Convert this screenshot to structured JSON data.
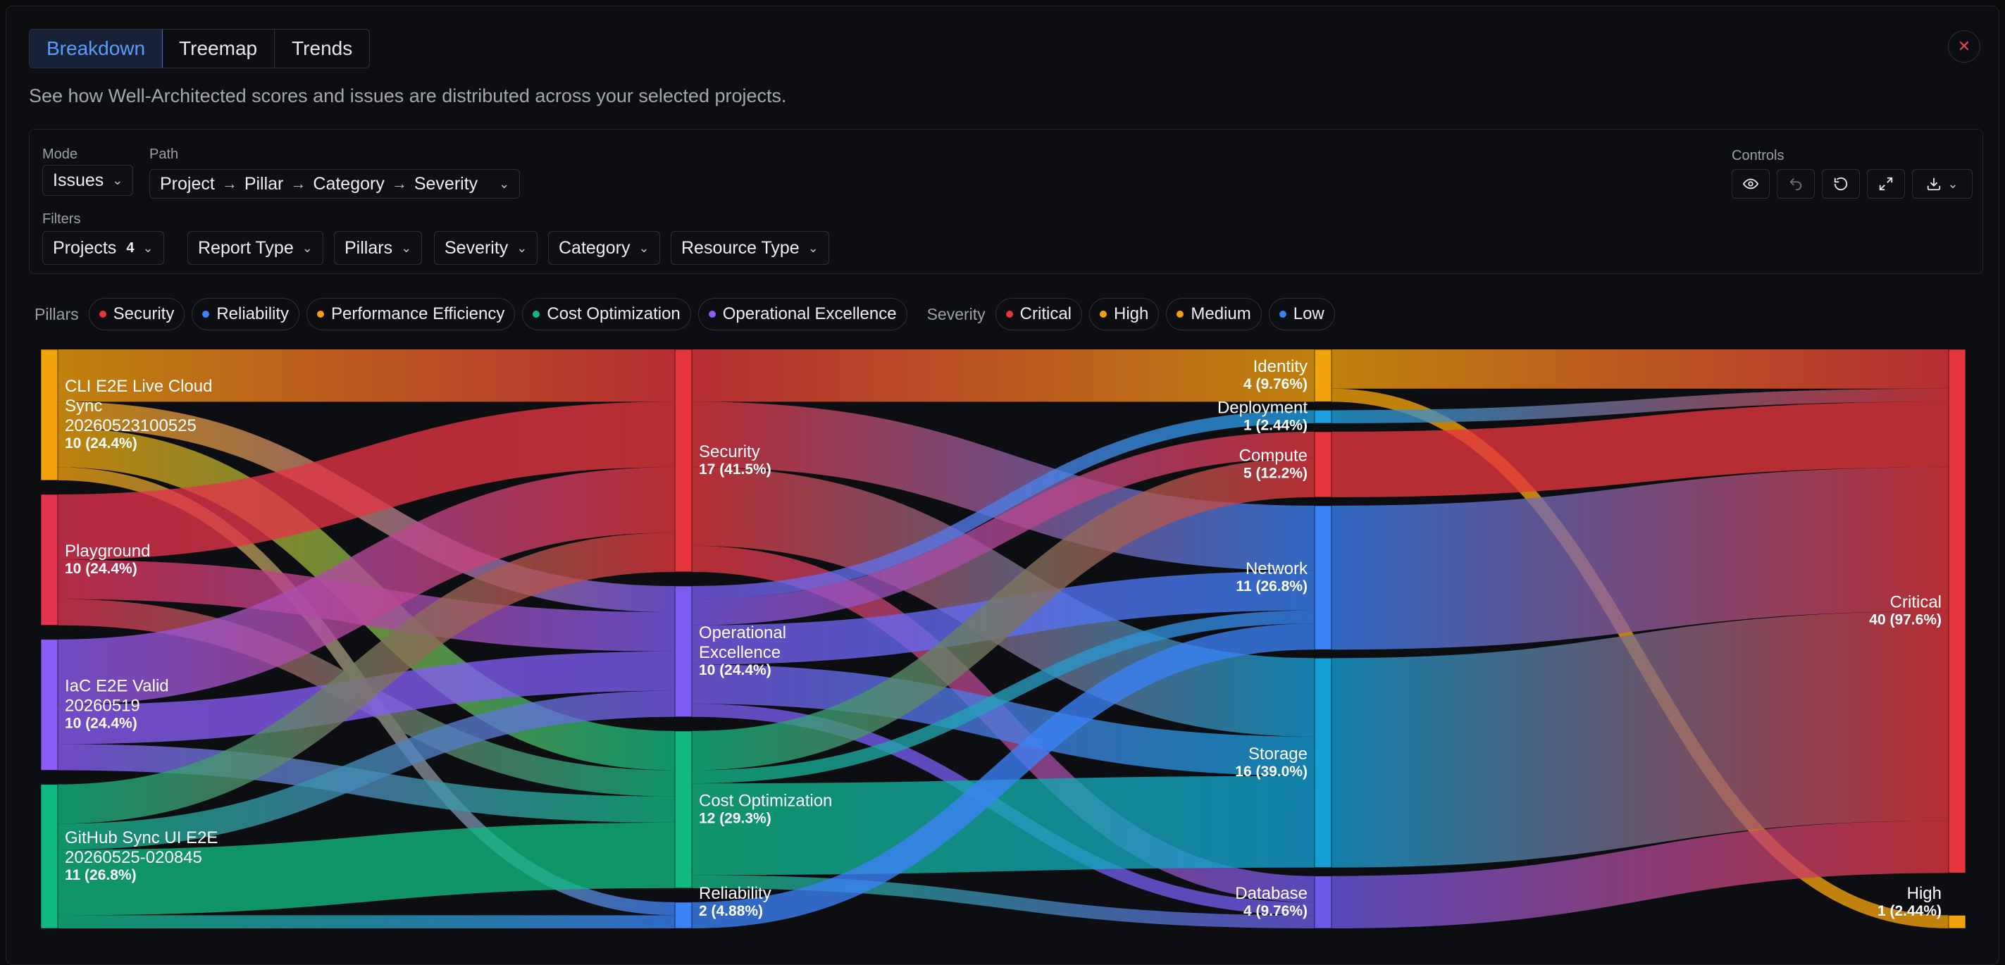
{
  "tabs": [
    {
      "label": "Breakdown",
      "active": true
    },
    {
      "label": "Treemap",
      "active": false
    },
    {
      "label": "Trends",
      "active": false
    }
  ],
  "close_icon": "close-icon",
  "subtitle": "See how Well-Architected scores and issues are distributed across your selected projects.",
  "controls": {
    "mode_label": "Mode",
    "mode_value": "Issues",
    "path_label": "Path",
    "path": [
      "Project",
      "Pillar",
      "Category",
      "Severity"
    ],
    "filters_label": "Filters",
    "filters": [
      {
        "label": "Projects",
        "count": "4"
      },
      {
        "label": "Report Type"
      },
      {
        "label": "Pillars"
      },
      {
        "label": "Severity"
      },
      {
        "label": "Category"
      },
      {
        "label": "Resource Type"
      }
    ],
    "controls_label": "Controls",
    "buttons": [
      "eye-icon",
      "undo-icon",
      "reset-icon",
      "expand-icon",
      "download-icon"
    ]
  },
  "legend": {
    "pillars_title": "Pillars",
    "pillars": [
      {
        "label": "Security",
        "color": "#e5363d"
      },
      {
        "label": "Reliability",
        "color": "#3b82f6"
      },
      {
        "label": "Performance Efficiency",
        "color": "#f59e0b"
      },
      {
        "label": "Cost Optimization",
        "color": "#10b981"
      },
      {
        "label": "Operational Excellence",
        "color": "#8b5cf6"
      }
    ],
    "severity_title": "Severity",
    "severity": [
      {
        "label": "Critical",
        "color": "#e5363d"
      },
      {
        "label": "High",
        "color": "#f59e0b"
      },
      {
        "label": "Medium",
        "color": "#f59e0b"
      },
      {
        "label": "Low",
        "color": "#3b82f6"
      }
    ]
  },
  "sankey": {
    "columns": [
      [
        {
          "id": "p1",
          "lines": [
            "CLI E2E Live Cloud",
            "Sync",
            "20260523100525"
          ],
          "value": 10,
          "pct": "10 (24.4%)",
          "color": "#f2a20c"
        },
        {
          "id": "p2",
          "lines": [
            "Playground"
          ],
          "value": 10,
          "pct": "10 (24.4%)",
          "color": "#e2334f"
        },
        {
          "id": "p3",
          "lines": [
            "IaC E2E Valid",
            "20260519"
          ],
          "value": 10,
          "pct": "10 (24.4%)",
          "color": "#8b5cf6"
        },
        {
          "id": "p4",
          "lines": [
            "GitHub Sync UI E2E",
            "20260525-020845"
          ],
          "value": 11,
          "pct": "11 (26.8%)",
          "color": "#10b981"
        }
      ],
      [
        {
          "id": "security",
          "lines": [
            "Security"
          ],
          "value": 17,
          "pct": "17 (41.5%)",
          "color": "#e5363d"
        },
        {
          "id": "opex",
          "lines": [
            "Operational",
            "Excellence"
          ],
          "value": 10,
          "pct": "10 (24.4%)",
          "color": "#7c5cf0"
        },
        {
          "id": "cost",
          "lines": [
            "Cost Optimization"
          ],
          "value": 12,
          "pct": "12 (29.3%)",
          "color": "#10b981"
        },
        {
          "id": "rel",
          "lines": [
            "Reliability"
          ],
          "value": 2,
          "pct": "2 (4.88%)",
          "color": "#3b82f6"
        }
      ],
      [
        {
          "id": "identity",
          "lines": [
            "Identity"
          ],
          "value": 4,
          "pct": "4 (9.76%)",
          "color": "#f2a20c"
        },
        {
          "id": "deployment",
          "lines": [
            "Deployment"
          ],
          "value": 1,
          "pct": "1 (2.44%)",
          "color": "#1fa0e0"
        },
        {
          "id": "compute",
          "lines": [
            "Compute"
          ],
          "value": 5,
          "pct": "5 (12.2%)",
          "color": "#e5363d"
        },
        {
          "id": "network",
          "lines": [
            "Network"
          ],
          "value": 11,
          "pct": "11 (26.8%)",
          "color": "#3b82f6"
        },
        {
          "id": "storage",
          "lines": [
            "Storage"
          ],
          "value": 16,
          "pct": "16 (39.0%)",
          "color": "#14a0d6"
        },
        {
          "id": "database",
          "lines": [
            "Database"
          ],
          "value": 4,
          "pct": "4 (9.76%)",
          "color": "#6d5ae8"
        }
      ],
      [
        {
          "id": "critical",
          "lines": [
            "Critical"
          ],
          "value": 40,
          "pct": "40 (97.6%)",
          "color": "#e5363d"
        },
        {
          "id": "high",
          "lines": [
            "High"
          ],
          "value": 1,
          "pct": "1 (2.44%)",
          "color": "#f2a20c"
        }
      ]
    ],
    "links": [
      {
        "source": "p1",
        "target": "security",
        "value": 4
      },
      {
        "source": "p1",
        "target": "opex",
        "value": 2
      },
      {
        "source": "p1",
        "target": "cost",
        "value": 3
      },
      {
        "source": "p1",
        "target": "rel",
        "value": 1
      },
      {
        "source": "p2",
        "target": "security",
        "value": 5
      },
      {
        "source": "p2",
        "target": "opex",
        "value": 3
      },
      {
        "source": "p2",
        "target": "cost",
        "value": 2
      },
      {
        "source": "p3",
        "target": "security",
        "value": 5
      },
      {
        "source": "p3",
        "target": "opex",
        "value": 3
      },
      {
        "source": "p3",
        "target": "cost",
        "value": 2
      },
      {
        "source": "p4",
        "target": "security",
        "value": 3
      },
      {
        "source": "p4",
        "target": "opex",
        "value": 2
      },
      {
        "source": "p4",
        "target": "cost",
        "value": 5
      },
      {
        "source": "p4",
        "target": "rel",
        "value": 1
      },
      {
        "source": "security",
        "target": "identity",
        "value": 4
      },
      {
        "source": "security",
        "target": "network",
        "value": 5
      },
      {
        "source": "security",
        "target": "storage",
        "value": 6
      },
      {
        "source": "security",
        "target": "database",
        "value": 2
      },
      {
        "source": "opex",
        "target": "deployment",
        "value": 1
      },
      {
        "source": "opex",
        "target": "compute",
        "value": 2
      },
      {
        "source": "opex",
        "target": "network",
        "value": 3
      },
      {
        "source": "opex",
        "target": "storage",
        "value": 3
      },
      {
        "source": "opex",
        "target": "database",
        "value": 1
      },
      {
        "source": "cost",
        "target": "compute",
        "value": 3
      },
      {
        "source": "cost",
        "target": "network",
        "value": 1
      },
      {
        "source": "cost",
        "target": "storage",
        "value": 7
      },
      {
        "source": "cost",
        "target": "database",
        "value": 1
      },
      {
        "source": "rel",
        "target": "network",
        "value": 2
      },
      {
        "source": "identity",
        "target": "critical",
        "value": 3
      },
      {
        "source": "identity",
        "target": "high",
        "value": 1
      },
      {
        "source": "deployment",
        "target": "critical",
        "value": 1
      },
      {
        "source": "compute",
        "target": "critical",
        "value": 5
      },
      {
        "source": "network",
        "target": "critical",
        "value": 11
      },
      {
        "source": "storage",
        "target": "critical",
        "value": 16
      },
      {
        "source": "database",
        "target": "critical",
        "value": 4
      }
    ]
  }
}
